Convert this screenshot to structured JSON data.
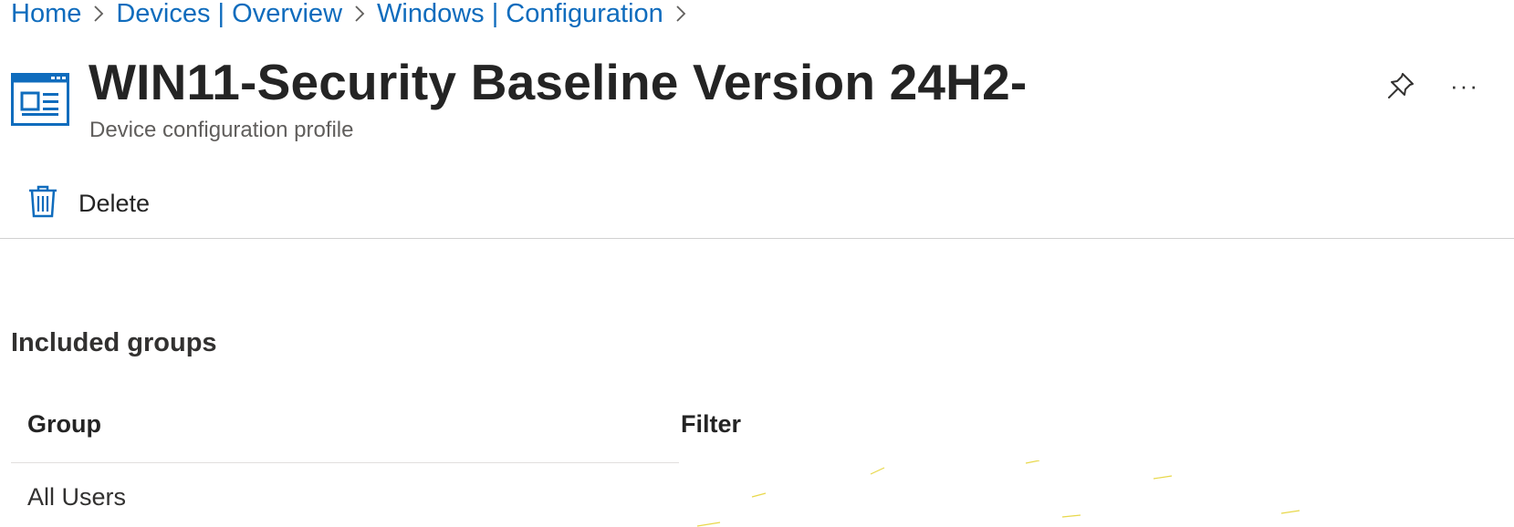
{
  "breadcrumb": [
    {
      "label": "Home"
    },
    {
      "label": "Devices | Overview"
    },
    {
      "label": "Windows | Configuration"
    }
  ],
  "header": {
    "title": "WIN11-Security Baseline Version 24H2-",
    "subtitle": "Device configuration profile",
    "icon": "config-profile-icon",
    "pin_icon": "pin-icon",
    "more_label": "···"
  },
  "toolbar": {
    "delete_label": "Delete",
    "delete_icon": "trash-icon"
  },
  "section": {
    "title": "Included groups",
    "columns": [
      "Group",
      "Filter"
    ],
    "rows": [
      {
        "group": "All Users",
        "filter": ""
      }
    ]
  },
  "colors": {
    "link": "#0f6cbd",
    "icon_blue": "#0f6cbd",
    "title": "#242424",
    "subtle": "#605e5c",
    "divider": "#d1d1d1"
  }
}
